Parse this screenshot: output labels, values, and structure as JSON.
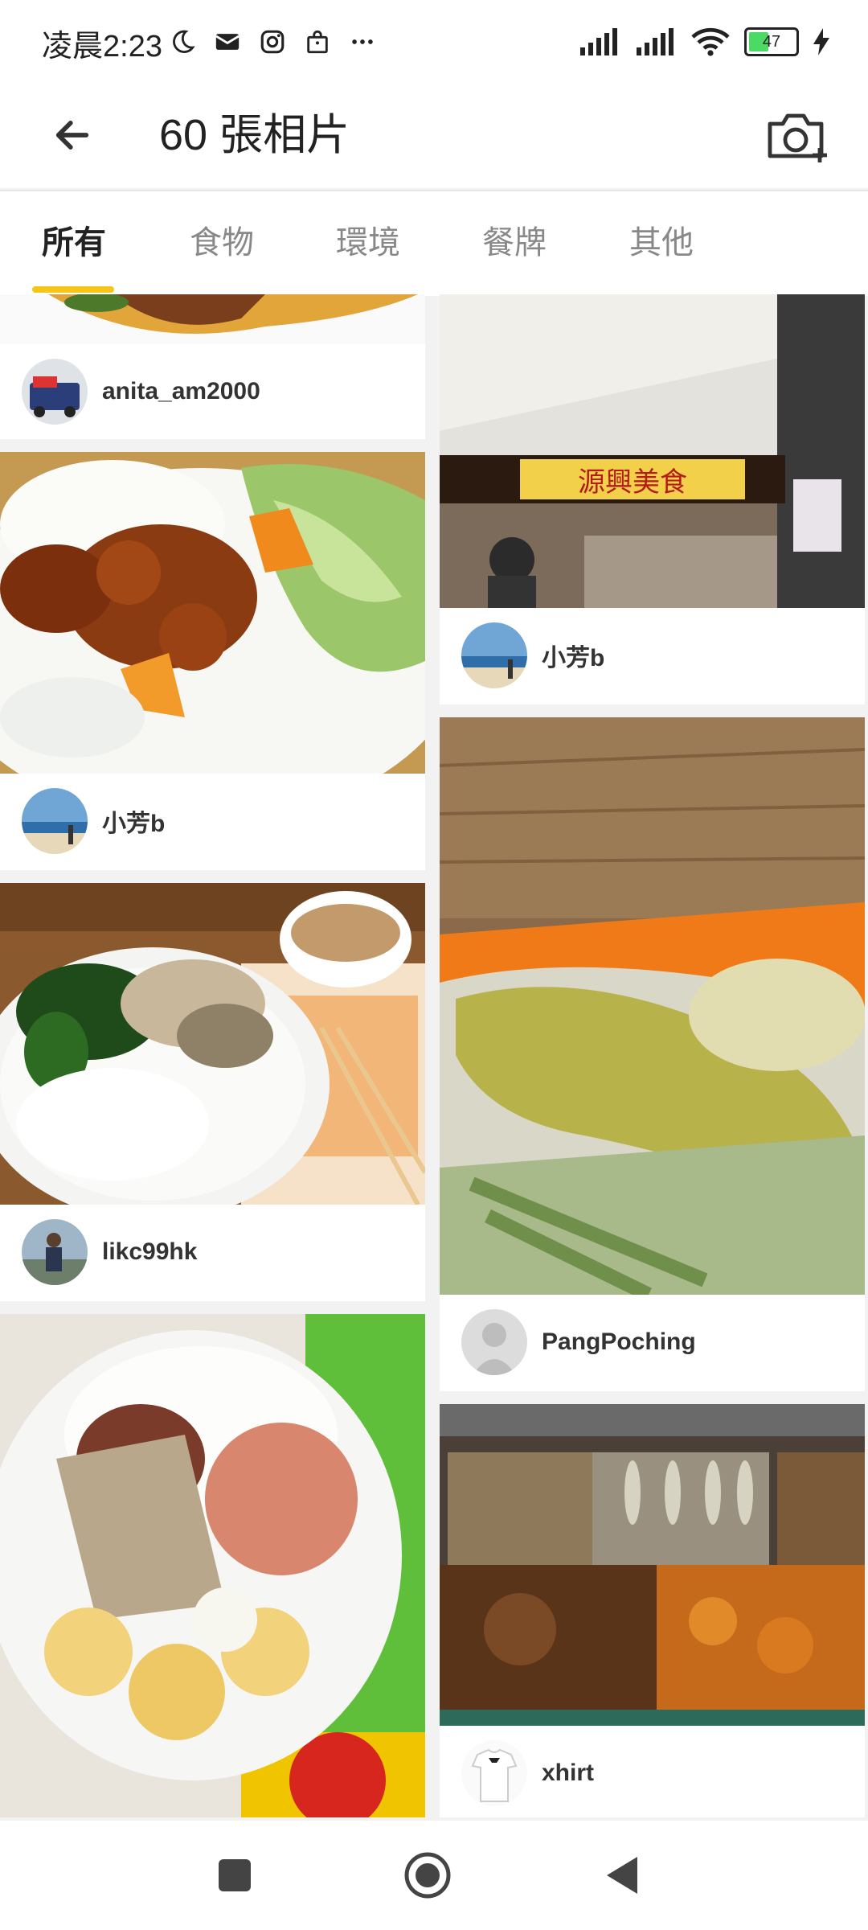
{
  "status_bar": {
    "time": "凌晨2:23",
    "battery": "47",
    "icons_left": [
      "moon-icon",
      "mail-icon",
      "instagram-icon",
      "shopping-bag-icon",
      "more-dots-icon"
    ],
    "icons_right": [
      "signal-icon",
      "signal-icon",
      "wifi-icon",
      "battery-icon",
      "charging-icon"
    ]
  },
  "header": {
    "title": "60 張相片",
    "back_icon": "back-arrow-icon",
    "camera_icon": "add-photo-camera-icon"
  },
  "tabs": [
    {
      "label": "所有",
      "active": true
    },
    {
      "label": "食物",
      "active": false
    },
    {
      "label": "環境",
      "active": false
    },
    {
      "label": "餐牌",
      "active": false
    },
    {
      "label": "其他",
      "active": false
    }
  ],
  "photos": [
    {
      "user": "anita_am2000",
      "subject": "food dish (partially visible)"
    },
    {
      "user": "小芳b",
      "subject": "restaurant storefront sign 源興美食"
    },
    {
      "user": "小芳b",
      "subject": "sweet and sour pork with rice and salad"
    },
    {
      "user": "PangPoching",
      "subject": "braised vegetable close-up"
    },
    {
      "user": "likc99hk",
      "subject": "rice plate with greens and fish, soup"
    },
    {
      "user": "xhirt",
      "subject": "buffet trays of fish and curry"
    },
    {
      "user": "",
      "subject": "rice plate with luncheon meat and potatoes"
    }
  ],
  "storefront_sign": "源興美食",
  "colors": {
    "accent": "#f5c518",
    "background": "#f2f2f2",
    "card": "#ffffff",
    "text_primary": "#222222",
    "text_inactive": "#888888"
  },
  "nav": {
    "icons": [
      "recents-square-icon",
      "home-circle-icon",
      "back-triangle-icon"
    ]
  }
}
